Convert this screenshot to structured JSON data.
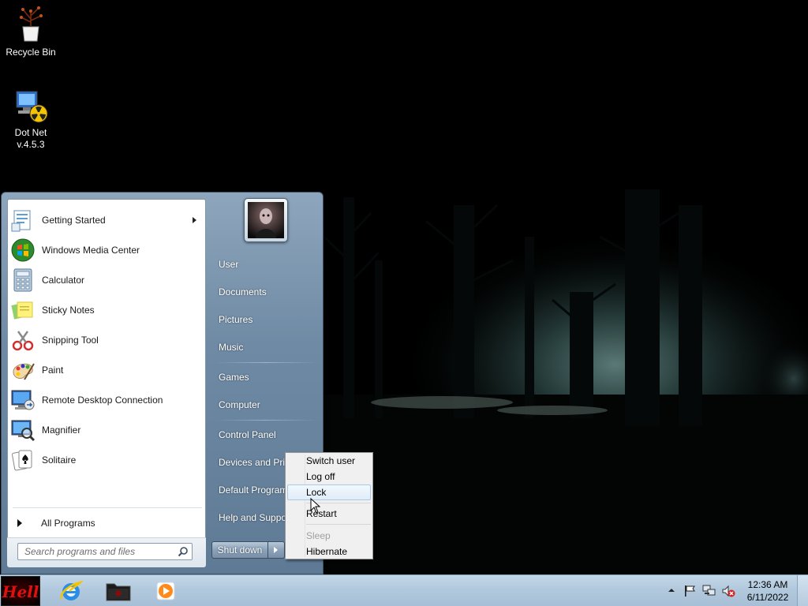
{
  "desktop": {
    "icons": [
      {
        "label": "Recycle Bin",
        "icon": "recycle-bin-icon"
      },
      {
        "label": "Dot Net v.4.5.3",
        "icon": "dotnet-installer-icon"
      }
    ]
  },
  "start_menu": {
    "programs": [
      {
        "label": "Getting Started",
        "icon": "getting-started-icon",
        "has_submenu": true
      },
      {
        "label": "Windows Media Center",
        "icon": "media-center-icon"
      },
      {
        "label": "Calculator",
        "icon": "calculator-icon"
      },
      {
        "label": "Sticky Notes",
        "icon": "sticky-notes-icon"
      },
      {
        "label": "Snipping Tool",
        "icon": "snipping-tool-icon"
      },
      {
        "label": "Paint",
        "icon": "paint-icon"
      },
      {
        "label": "Remote Desktop Connection",
        "icon": "remote-desktop-icon"
      },
      {
        "label": "Magnifier",
        "icon": "magnifier-icon"
      },
      {
        "label": "Solitaire",
        "icon": "solitaire-icon"
      }
    ],
    "all_programs_label": "All Programs",
    "search_placeholder": "Search programs and files",
    "places": [
      {
        "label": "User"
      },
      {
        "label": "Documents"
      },
      {
        "label": "Pictures"
      },
      {
        "label": "Music"
      },
      {
        "label": "Games"
      },
      {
        "label": "Computer"
      },
      {
        "label": "Control Panel"
      },
      {
        "label": "Devices and Printers"
      },
      {
        "label": "Default Programs"
      },
      {
        "label": "Help and Support"
      }
    ],
    "shutdown_label": "Shut down"
  },
  "power_menu": {
    "items": [
      {
        "label": "Switch user",
        "enabled": true
      },
      {
        "label": "Log off",
        "enabled": true
      },
      {
        "label": "Lock",
        "enabled": true,
        "highlighted": true
      },
      {
        "label": "Restart",
        "enabled": true
      },
      {
        "label": "Sleep",
        "enabled": false
      },
      {
        "label": "Hibernate",
        "enabled": true
      }
    ]
  },
  "taskbar": {
    "start_button_text": "Hell",
    "pinned": [
      {
        "icon": "internet-explorer-icon"
      },
      {
        "icon": "file-explorer-icon"
      },
      {
        "icon": "media-player-icon"
      }
    ],
    "tray_icons": [
      "show-hidden-icons-icon",
      "action-center-flag-icon",
      "network-icon",
      "volume-muted-icon"
    ],
    "clock": {
      "time": "12:36 AM",
      "date": "6/11/2022"
    }
  },
  "colors": {
    "start_menu_frame": "#6f8aa4",
    "taskbar": "#b2c9dd",
    "wallpaper_mist": "#2f4a4a"
  }
}
